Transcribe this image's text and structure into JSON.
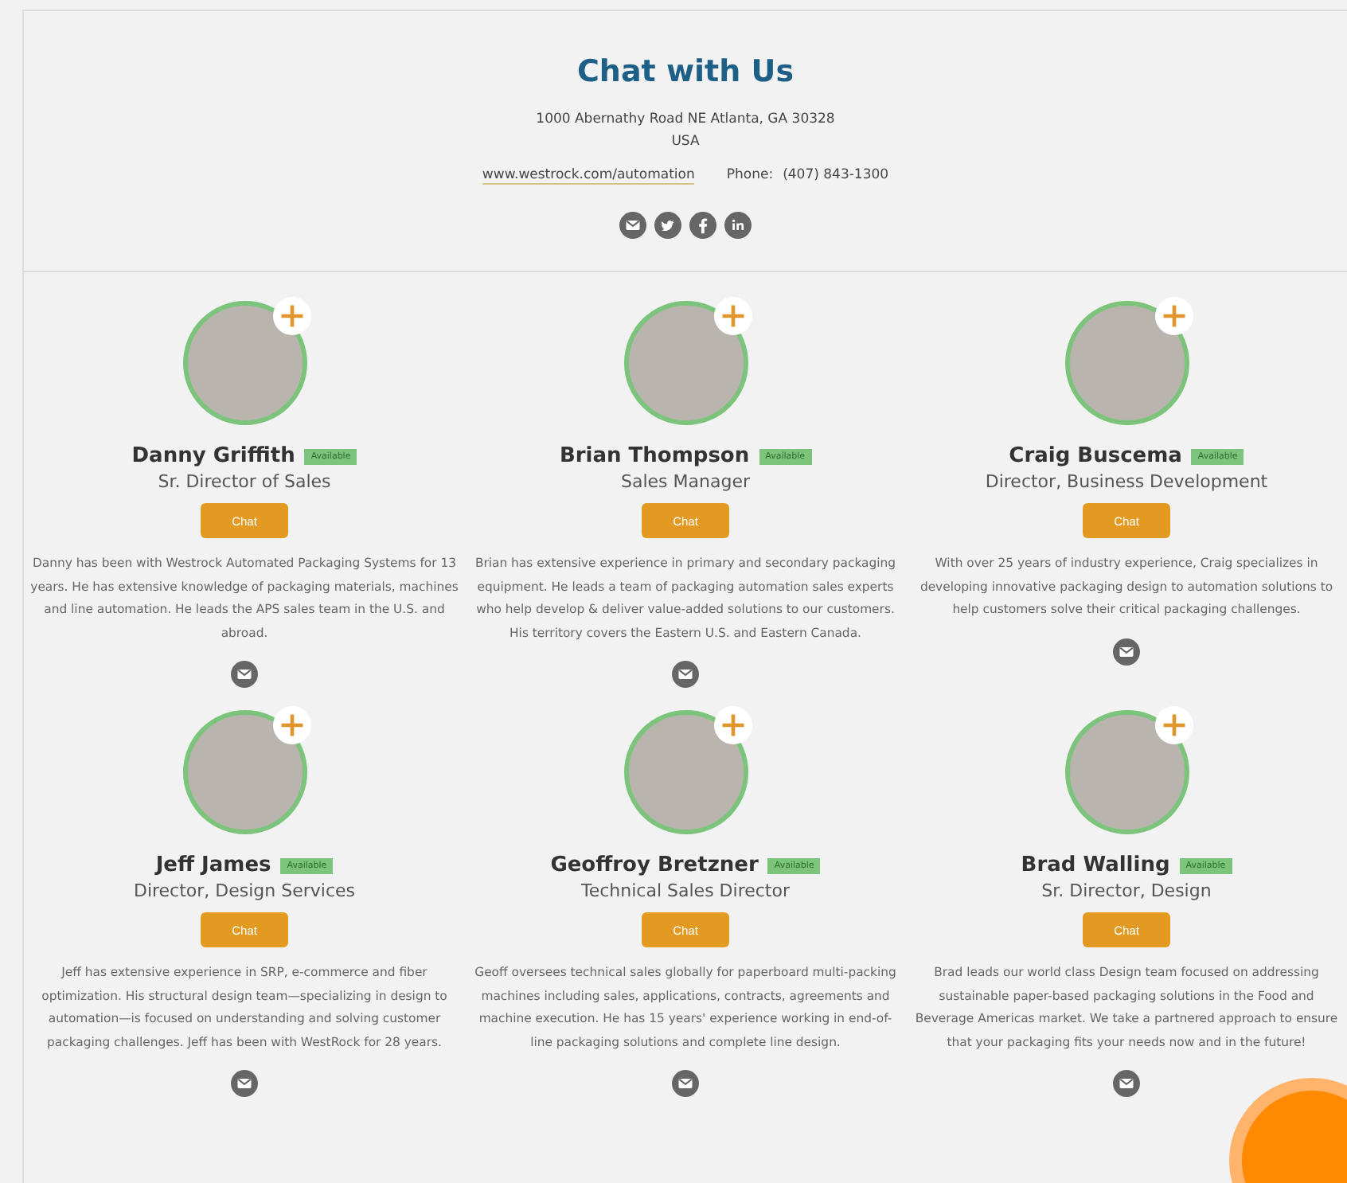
{
  "header": {
    "title": "Chat with Us",
    "address_lines": [
      "1000 Abernathy Road NE Atlanta, GA 30328",
      "USA"
    ],
    "website": "www.westrock.com/automation",
    "phone_label": "Phone:",
    "phone": "(407) 843-1300",
    "social_links": [
      {
        "kind": "email"
      },
      {
        "kind": "twitter"
      },
      {
        "kind": "facebook"
      },
      {
        "kind": "linkedin"
      }
    ]
  },
  "contacts": [
    {
      "name": "Danny Griffith",
      "status": "Available",
      "title": "Sr. Director of Sales",
      "button": "Chat",
      "bio": "Danny has been with Westrock Automated Packaging Systems for 13 years. He has extensive knowledge of packaging materials, machines and line automation. He leads the APS sales team in the U.S. and abroad."
    },
    {
      "name": "Brian Thompson",
      "status": "Available",
      "title": "Sales Manager",
      "button": "Chat",
      "bio": "Brian has extensive experience in primary and secondary packaging equipment. He leads a team of packaging automation sales experts who help develop & deliver value-added solutions to our customers. His territory covers the Eastern U.S. and Eastern Canada."
    },
    {
      "name": "Craig Buscema",
      "status": "Available",
      "title": "Director, Business Development",
      "button": "Chat",
      "bio": "With over 25 years of industry experience, Craig specializes in developing innovative packaging design to automation solutions to help customers solve their critical packaging challenges."
    },
    {
      "name": "Jeff James",
      "status": "Available",
      "title": "Director, Design Services",
      "button": "Chat",
      "bio": "Jeff has extensive experience in SRP, e-commerce and fiber optimization. His structural design team—specializing in design to automation—is focused on understanding and solving customer packaging challenges. Jeff has been with WestRock for 28 years."
    },
    {
      "name": "Geoffroy Bretzner",
      "status": "Available",
      "title": "Technical Sales Director",
      "button": "Chat",
      "bio": "Geoff oversees technical sales globally for paperboard multi-packing machines including sales, applications, contracts, agreements and machine execution. He has 15 years' experience working in end-of-line packaging solutions and complete line design."
    },
    {
      "name": "Brad Walling",
      "status": "Available",
      "title": "Sr. Director, Design",
      "button": "Chat",
      "bio": "Brad leads our world class Design team focused on addressing sustainable paper-based packaging solutions in the Food and Beverage Americas market. We take a partnered approach to ensure that your packaging fits your needs now and in the future!"
    }
  ]
}
